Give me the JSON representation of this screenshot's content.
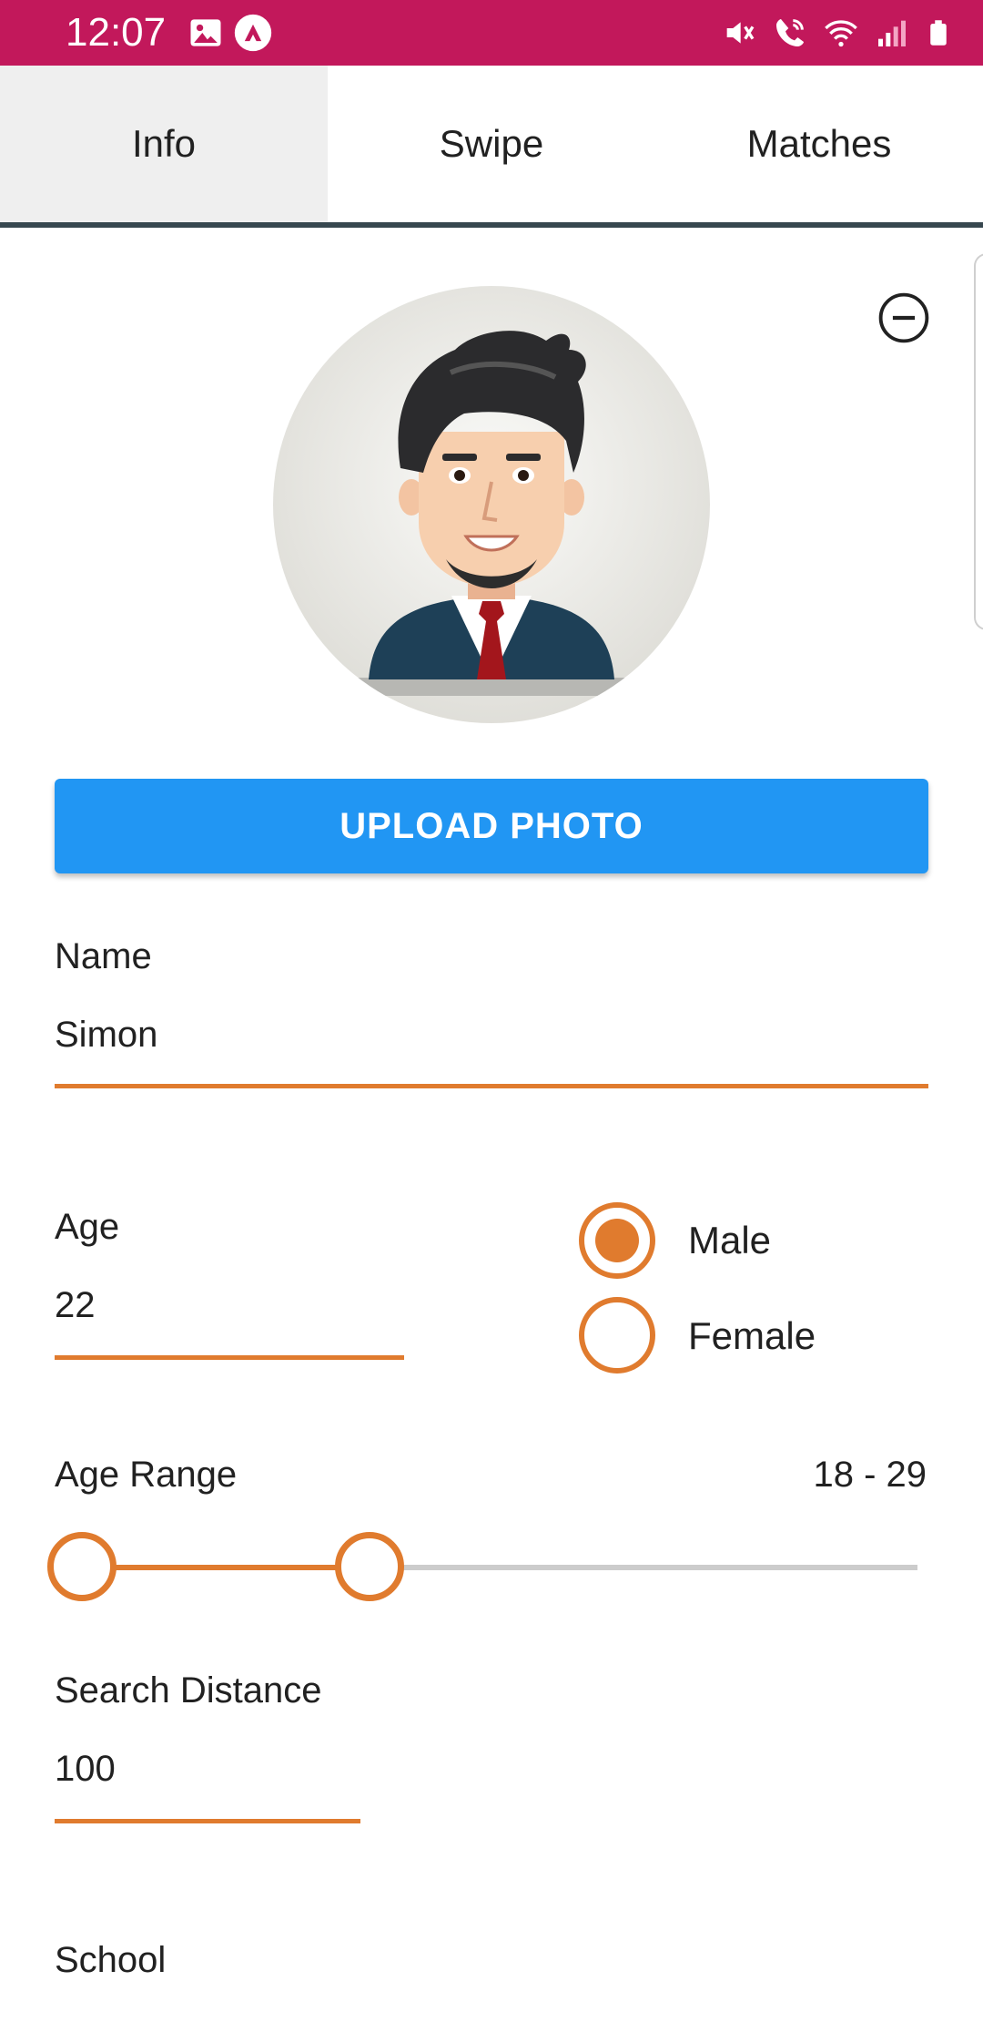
{
  "status_bar": {
    "time": "12:07",
    "left_icons": [
      "image-icon",
      "app-notification-icon"
    ],
    "right_icons": [
      "mute-icon",
      "wifi-calling-icon",
      "wifi-icon",
      "signal-icon",
      "battery-icon"
    ]
  },
  "tabs": [
    {
      "label": "Info",
      "active": true
    },
    {
      "label": "Swipe",
      "active": false
    },
    {
      "label": "Matches",
      "active": false
    }
  ],
  "profile": {
    "upload_label": "UPLOAD PHOTO",
    "avatar_icon": "profile-avatar-image",
    "remove_icon": "remove-circle-icon"
  },
  "form": {
    "name_label": "Name",
    "name_value": "Simon",
    "age_label": "Age",
    "age_value": "22",
    "gender_options": [
      {
        "label": "Male",
        "selected": true
      },
      {
        "label": "Female",
        "selected": false
      }
    ],
    "age_range_label": "Age Range",
    "age_range_value": "18 - 29",
    "age_range_min": 18,
    "age_range_max": 29,
    "search_distance_label": "Search Distance",
    "search_distance_value": "100",
    "school_label": "School"
  },
  "colors": {
    "status_bar": "#c2185b",
    "accent": "#e07b2e",
    "button": "#2196f3",
    "tab_indicator": "#37474f",
    "active_tab_bg": "#efefef"
  }
}
